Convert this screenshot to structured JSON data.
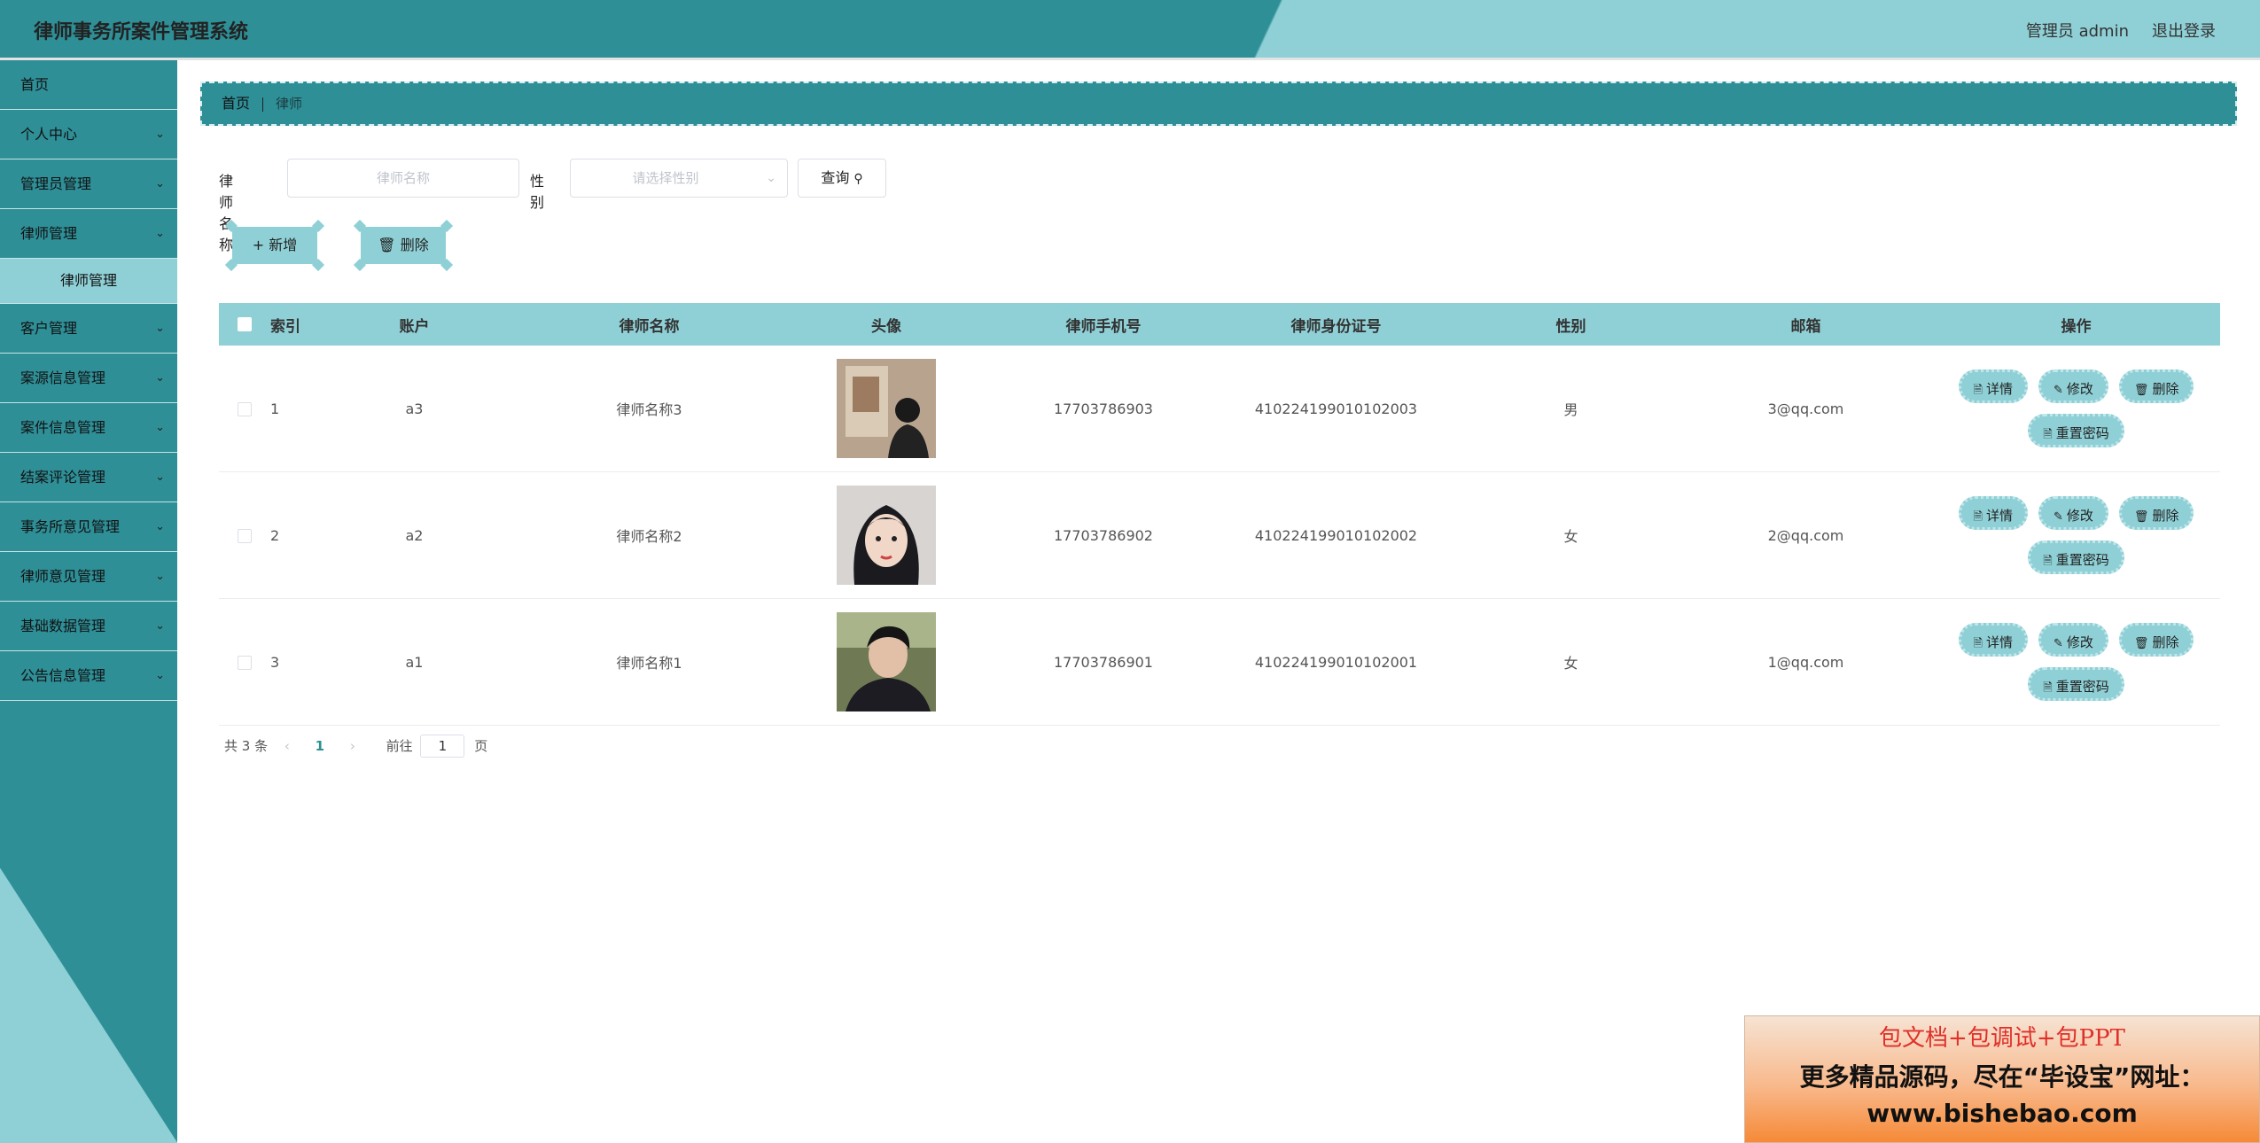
{
  "header": {
    "title": "律师事务所案件管理系统",
    "admin": "管理员 admin",
    "logout": "退出登录"
  },
  "sidebar": {
    "items": [
      {
        "label": "首页",
        "expandable": false
      },
      {
        "label": "个人中心",
        "expandable": true
      },
      {
        "label": "管理员管理",
        "expandable": true
      },
      {
        "label": "律师管理",
        "expandable": true
      },
      {
        "label": "客户管理",
        "expandable": true
      },
      {
        "label": "案源信息管理",
        "expandable": true
      },
      {
        "label": "案件信息管理",
        "expandable": true
      },
      {
        "label": "结案评论管理",
        "expandable": true
      },
      {
        "label": "事务所意见管理",
        "expandable": true
      },
      {
        "label": "律师意见管理",
        "expandable": true
      },
      {
        "label": "基础数据管理",
        "expandable": true
      },
      {
        "label": "公告信息管理",
        "expandable": true
      }
    ],
    "submenu": {
      "parent": "律师管理",
      "label": "律师管理"
    }
  },
  "breadcrumb": {
    "home": "首页",
    "current": "律师"
  },
  "search": {
    "name_label": "律师名称",
    "name_placeholder": "律师名称",
    "sex_label": "性别",
    "sex_placeholder": "请选择性别",
    "query_label": "查询"
  },
  "actions": {
    "add": "新增",
    "delete": "删除"
  },
  "table": {
    "headers": [
      "索引",
      "账户",
      "律师名称",
      "头像",
      "律师手机号",
      "律师身份证号",
      "性别",
      "邮箱",
      "操作"
    ],
    "rows": [
      {
        "index": "1",
        "account": "a3",
        "name": "律师名称3",
        "phone": "17703786903",
        "id_number": "410224199010102003",
        "sex": "男",
        "email": "3@qq.com"
      },
      {
        "index": "2",
        "account": "a2",
        "name": "律师名称2",
        "phone": "17703786902",
        "id_number": "410224199010102002",
        "sex": "女",
        "email": "2@qq.com"
      },
      {
        "index": "3",
        "account": "a1",
        "name": "律师名称1",
        "phone": "17703786901",
        "id_number": "410224199010102001",
        "sex": "女",
        "email": "1@qq.com"
      }
    ],
    "row_ops": {
      "detail": "详情",
      "edit": "修改",
      "delete": "删除",
      "reset": "重置密码"
    }
  },
  "pagination": {
    "total": "共 3 条",
    "current_page": "1",
    "goto_label": "前往",
    "goto_value": "1",
    "page_suffix": "页"
  },
  "ad": {
    "line1": "包文档+包调试+包PPT",
    "line2": "更多精品源码，尽在“毕设宝”网址：",
    "line3": "www.bishebao.com"
  },
  "colors": {
    "primary": "#2e8f97",
    "light": "#8fd0d6"
  }
}
